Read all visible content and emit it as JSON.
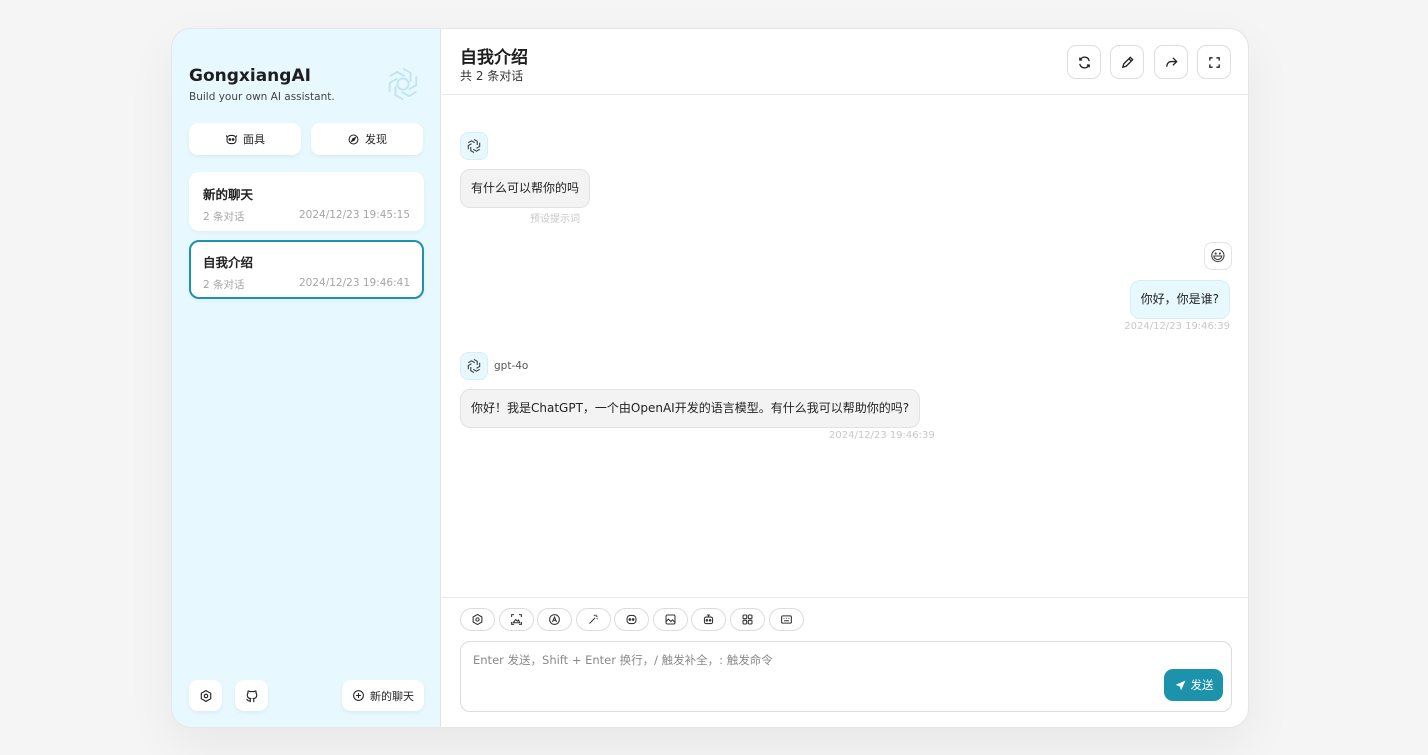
{
  "sidebar": {
    "app_name": "GongxiangAI",
    "app_subtitle": "Build your own AI assistant.",
    "masks_button": "面具",
    "discover_button": "发现",
    "chats": [
      {
        "title": "新的聊天",
        "count": "2 条对话",
        "time": "2024/12/23 19:45:15",
        "selected": false
      },
      {
        "title": "自我介绍",
        "count": "2 条对话",
        "time": "2024/12/23 19:46:41",
        "selected": true
      }
    ],
    "new_chat_button": "新的聊天"
  },
  "header": {
    "title": "自我介绍",
    "subtitle": "共 2 条对话"
  },
  "messages": [
    {
      "role": "assistant",
      "text": "有什么可以帮你的吗",
      "meta": "预设提示词"
    },
    {
      "role": "user",
      "avatar_emoji": "😃",
      "text": "你好，你是谁?",
      "meta": "2024/12/23 19:46:39"
    },
    {
      "role": "assistant",
      "model": "gpt-4o",
      "text": "你好！我是ChatGPT，一个由OpenAI开发的语言模型。有什么我可以帮助你的吗?",
      "meta": "2024/12/23 19:46:39"
    }
  ],
  "input": {
    "placeholder": "Enter 发送，Shift + Enter 换行，/ 触发补全，: 触发命令",
    "value": "",
    "send_label": "发送"
  },
  "toolbar_icons": [
    "settings-icon",
    "image-upload-icon",
    "model-select-icon",
    "magic-wand-icon",
    "mask-icon",
    "image-gen-icon",
    "robot-icon",
    "plugin-grid-icon",
    "shortcut-keyboard-icon"
  ],
  "colors": {
    "accent": "#1d93ab",
    "sidebar_bg": "#e7f8ff",
    "user_bubble_bg": "#e7f8ff",
    "bot_bubble_bg": "#f3f3f3"
  }
}
